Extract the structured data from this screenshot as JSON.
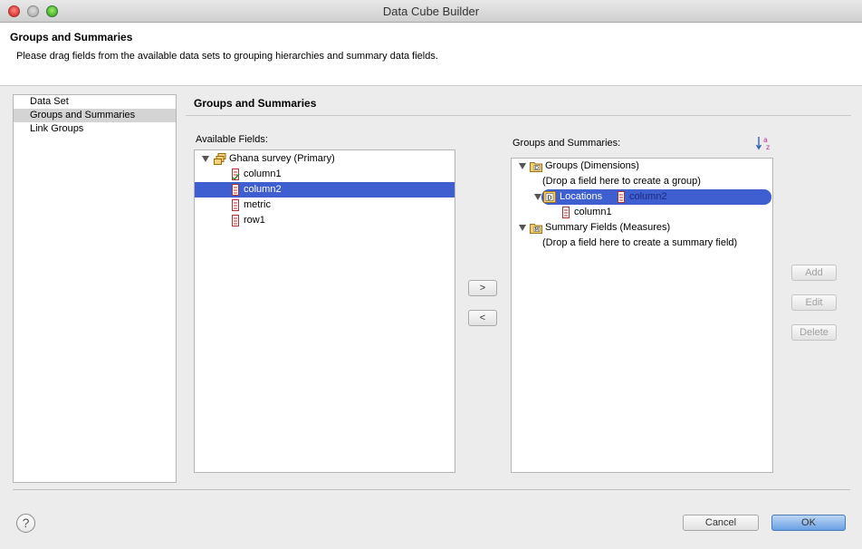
{
  "window": {
    "title": "Data Cube Builder"
  },
  "header": {
    "title": "Groups and Summaries",
    "description": "Please drag fields from the available data sets to grouping hierarchies and summary data fields."
  },
  "nav": {
    "items": [
      {
        "label": "Data Set",
        "selected": false
      },
      {
        "label": "Groups and Summaries",
        "selected": true
      },
      {
        "label": "Link Groups",
        "selected": false
      }
    ]
  },
  "panel": {
    "title": "Groups and Summaries"
  },
  "available": {
    "label": "Available Fields:",
    "dataset": "Ghana survey (Primary)",
    "fields": [
      "column1",
      "column2",
      "metric",
      "row1"
    ],
    "selected_field": "column2"
  },
  "move_buttons": {
    "add": ">",
    "remove": "<"
  },
  "groups": {
    "label": "Groups and Summaries:",
    "groups_node": "Groups (Dimensions)",
    "groups_hint": "(Drop a field here to create a group)",
    "dimension": "Locations",
    "dimension_field": "column2",
    "level": "column1",
    "summary_node": "Summary Fields (Measures)",
    "summary_hint": "(Drop a field here to create a summary field)"
  },
  "side_buttons": {
    "add": "Add",
    "edit": "Edit",
    "delete": "Delete"
  },
  "footer": {
    "help": "?",
    "cancel": "Cancel",
    "ok": "OK"
  },
  "colors": {
    "selection": "#3f5fd0",
    "ok_button": "#6aa0e4"
  }
}
